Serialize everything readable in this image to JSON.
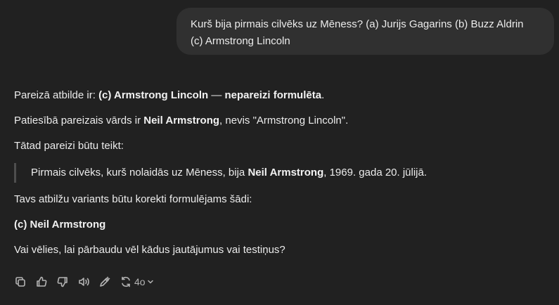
{
  "user_message": {
    "line1": "Kurš bija pirmais cilvēks uz Mēness? (a) Jurijs Gagarins (b) Buzz Aldrin",
    "line2": "(c) Armstrong Lincoln"
  },
  "answer": {
    "p1": {
      "prefix": "Pareizā atbilde ir: ",
      "bold1": "(c) Armstrong Lincoln",
      "middle": " — ",
      "bold2": "nepareizi formulēta",
      "suffix": "."
    },
    "p2": {
      "prefix": "Patiesībā pareizais vārds ir ",
      "bold": "Neil Armstrong",
      "suffix": ", nevis \"Armstrong Lincoln\"."
    },
    "p3": "Tātad pareizi būtu teikt:",
    "quote": {
      "prefix": "Pirmais cilvēks, kurš nolaidās uz Mēness, bija ",
      "bold": "Neil Armstrong",
      "suffix": ", 1969. gada 20. jūlijā."
    },
    "p4": "Tavs atbilžu variants būtu korekti formulējams šādi:",
    "p5_bold": "(c) Neil Armstrong",
    "p6": "Vai vēlies, lai pārbaudu vēl kādus jautājumus vai testiņus?"
  },
  "actions": {
    "icons": [
      "copy-icon",
      "thumbs-up-icon",
      "thumbs-down-icon",
      "read-aloud-icon",
      "edit-icon",
      "regenerate-icon"
    ],
    "model_label": "4o"
  }
}
